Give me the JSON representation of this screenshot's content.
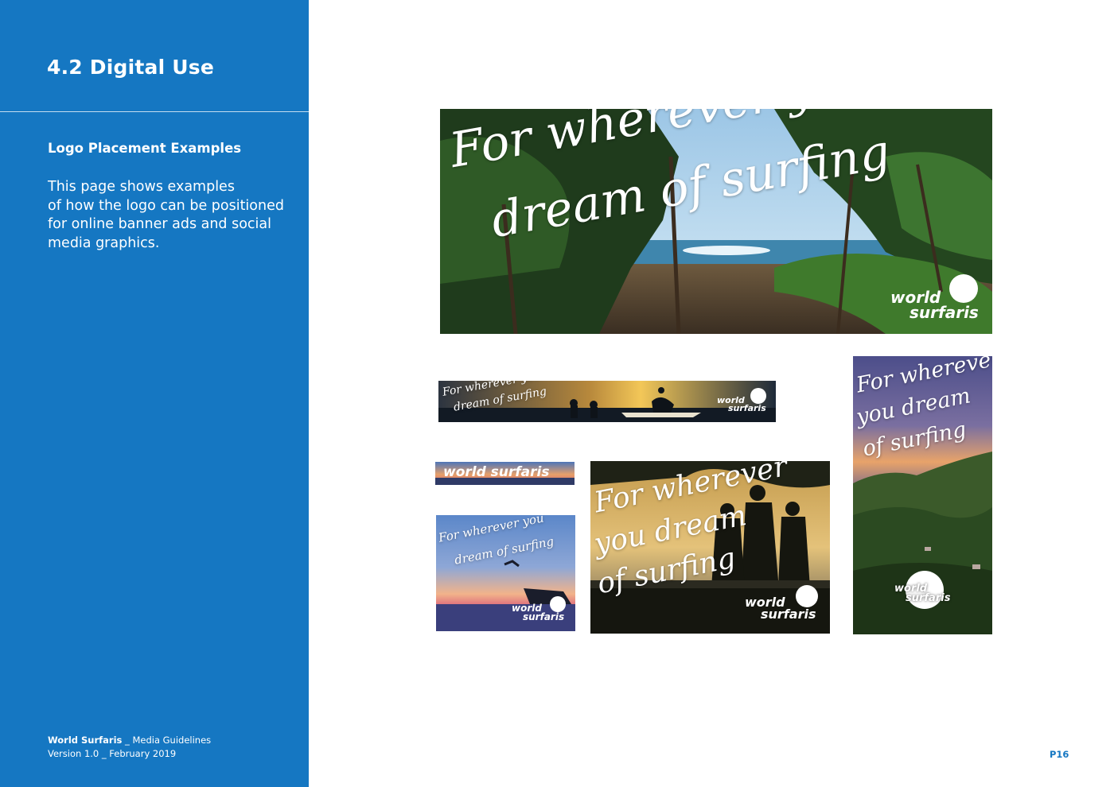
{
  "sidebar": {
    "section_title": "4.2  Digital Use",
    "sub_title": "Logo Placement Examples",
    "body_lines": [
      "This page shows examples",
      "of how the logo can be positioned",
      "for online banner ads and social",
      "media graphics."
    ],
    "footer": {
      "brand": "World Surfaris",
      "doc": " _ Media Guidelines",
      "version": "Version 1.0 _ February 2019"
    }
  },
  "page_number": "P16",
  "ads": {
    "leaderboard": {
      "tagline_1": "For wherever you",
      "tagline_2": "dream of surfing",
      "brand_1": "world",
      "brand_2": "surfaris"
    },
    "wide_banner": {
      "tagline_1": "For wherever you",
      "tagline_2": "dream of surfing",
      "brand_1": "world",
      "brand_2": "surfaris"
    },
    "mini_banner": {
      "brand": "world surfaris"
    },
    "square_sunset": {
      "tagline_1": "For wherever you",
      "tagline_2": "dream of surfing",
      "brand_1": "world",
      "brand_2": "surfaris"
    },
    "rectangle_group": {
      "tagline_1": "For wherever",
      "tagline_2": "you dream",
      "tagline_3": "of surfing",
      "brand_1": "world",
      "brand_2": "surfaris"
    },
    "skyscraper": {
      "tagline_1": "For wherever",
      "tagline_2": "you dream",
      "tagline_3": "of surfing",
      "brand_1": "world",
      "brand_2": "surfaris"
    }
  },
  "colors": {
    "brand_blue": "#1577c2",
    "text_on_blue": "#ffffff"
  }
}
